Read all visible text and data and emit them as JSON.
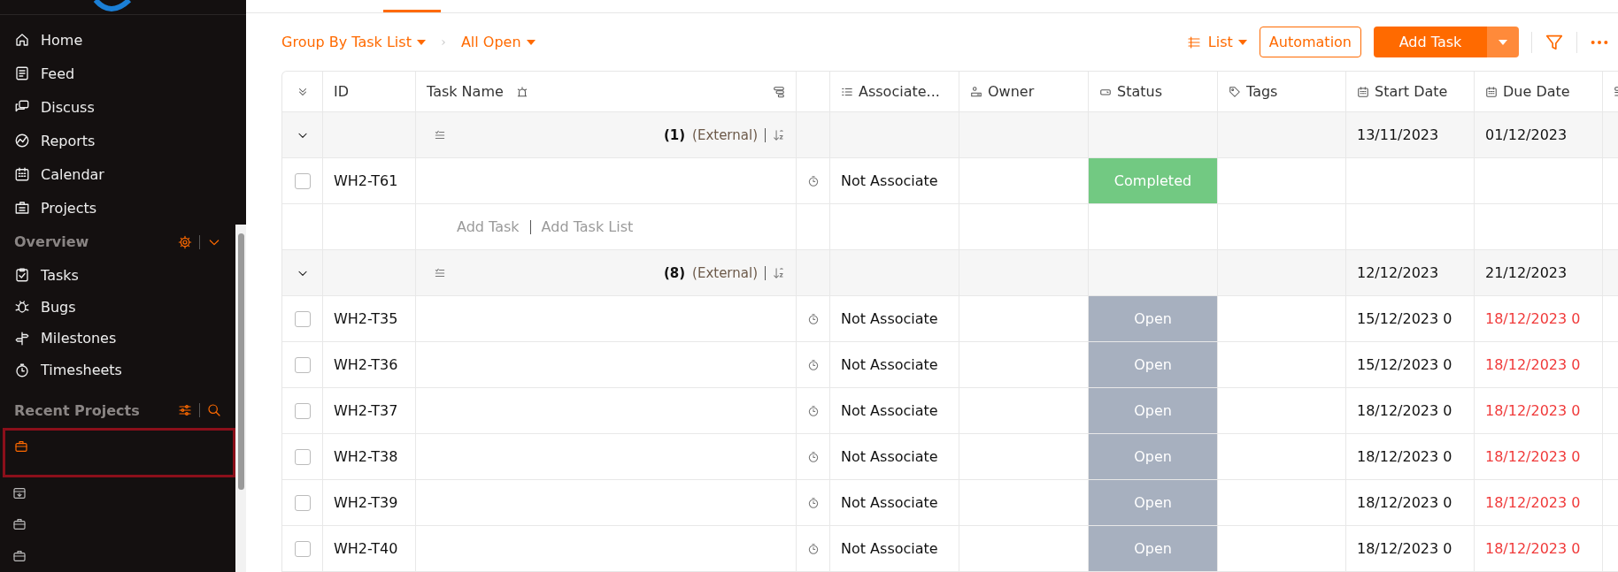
{
  "sidebar": {
    "nav_items": [
      {
        "label": "Home"
      },
      {
        "label": "Feed"
      },
      {
        "label": "Discuss"
      },
      {
        "label": "Reports"
      },
      {
        "label": "Calendar"
      },
      {
        "label": "Projects"
      }
    ],
    "overview": {
      "title": "Overview",
      "expanded": true,
      "items": [
        {
          "label": "Tasks"
        },
        {
          "label": "Bugs"
        },
        {
          "label": "Milestones"
        },
        {
          "label": "Timesheets"
        }
      ]
    },
    "recent_projects": {
      "title": "Recent Projects",
      "items": [
        {
          "kind": "project",
          "selected": true
        },
        {
          "kind": "archived",
          "selected": false
        },
        {
          "kind": "project",
          "selected": false
        },
        {
          "kind": "project",
          "selected": false
        }
      ]
    }
  },
  "toolbar": {
    "group_by": "Group By Task List",
    "filter": "All Open",
    "view": "List",
    "automation": "Automation",
    "add_task": "Add Task"
  },
  "table": {
    "columns": [
      {
        "label": "ID",
        "kind": "id"
      },
      {
        "label": "Task Name",
        "kind": "name"
      },
      {
        "kind": "timer"
      },
      {
        "label": "Associate...",
        "kind": "associated"
      },
      {
        "label": "Owner",
        "kind": "owner"
      },
      {
        "label": "Status",
        "kind": "status"
      },
      {
        "label": "Tags",
        "kind": "tags"
      },
      {
        "label": "Start Date",
        "kind": "start"
      },
      {
        "label": "Due Date",
        "kind": "due"
      }
    ],
    "rows": [
      {
        "kind": "group",
        "expanded": true,
        "count": "(1)",
        "label": "(External)",
        "start": "13/11/2023",
        "due": "01/12/2023"
      },
      {
        "kind": "task",
        "checked": false,
        "id": "WH2-T61",
        "associated": "Not Associate",
        "status": "Completed",
        "color": "#72c982",
        "start": "",
        "due": ""
      },
      {
        "kind": "add",
        "add_task": "Add Task",
        "add_list": "Add Task List"
      },
      {
        "kind": "group",
        "expanded": true,
        "count": "(8)",
        "label": "(External)",
        "start": "12/12/2023",
        "due": "21/12/2023"
      },
      {
        "kind": "task",
        "checked": false,
        "id": "WH2-T35",
        "associated": "Not Associate",
        "status": "Open",
        "color": "#a7b0bf",
        "start": "15/12/2023 0",
        "due": "18/12/2023 0",
        "overdue": true
      },
      {
        "kind": "task",
        "checked": false,
        "id": "WH2-T36",
        "associated": "Not Associate",
        "status": "Open",
        "color": "#a7b0bf",
        "start": "15/12/2023 0",
        "due": "18/12/2023 0",
        "overdue": true
      },
      {
        "kind": "task",
        "checked": false,
        "id": "WH2-T37",
        "associated": "Not Associate",
        "status": "Open",
        "color": "#a7b0bf",
        "start": "18/12/2023 0",
        "due": "18/12/2023 0",
        "overdue": true
      },
      {
        "kind": "task",
        "checked": false,
        "id": "WH2-T38",
        "associated": "Not Associate",
        "status": "Open",
        "color": "#a7b0bf",
        "start": "18/12/2023 0",
        "due": "18/12/2023 0",
        "overdue": true
      },
      {
        "kind": "task",
        "checked": false,
        "id": "WH2-T39",
        "associated": "Not Associate",
        "status": "Open",
        "color": "#a7b0bf",
        "start": "18/12/2023 0",
        "due": "18/12/2023 0",
        "overdue": true
      },
      {
        "kind": "task",
        "checked": false,
        "id": "WH2-T40",
        "associated": "Not Associate",
        "status": "Open",
        "color": "#a7b0bf",
        "start": "18/12/2023 0",
        "due": "18/12/2023 0",
        "overdue": true
      }
    ]
  }
}
